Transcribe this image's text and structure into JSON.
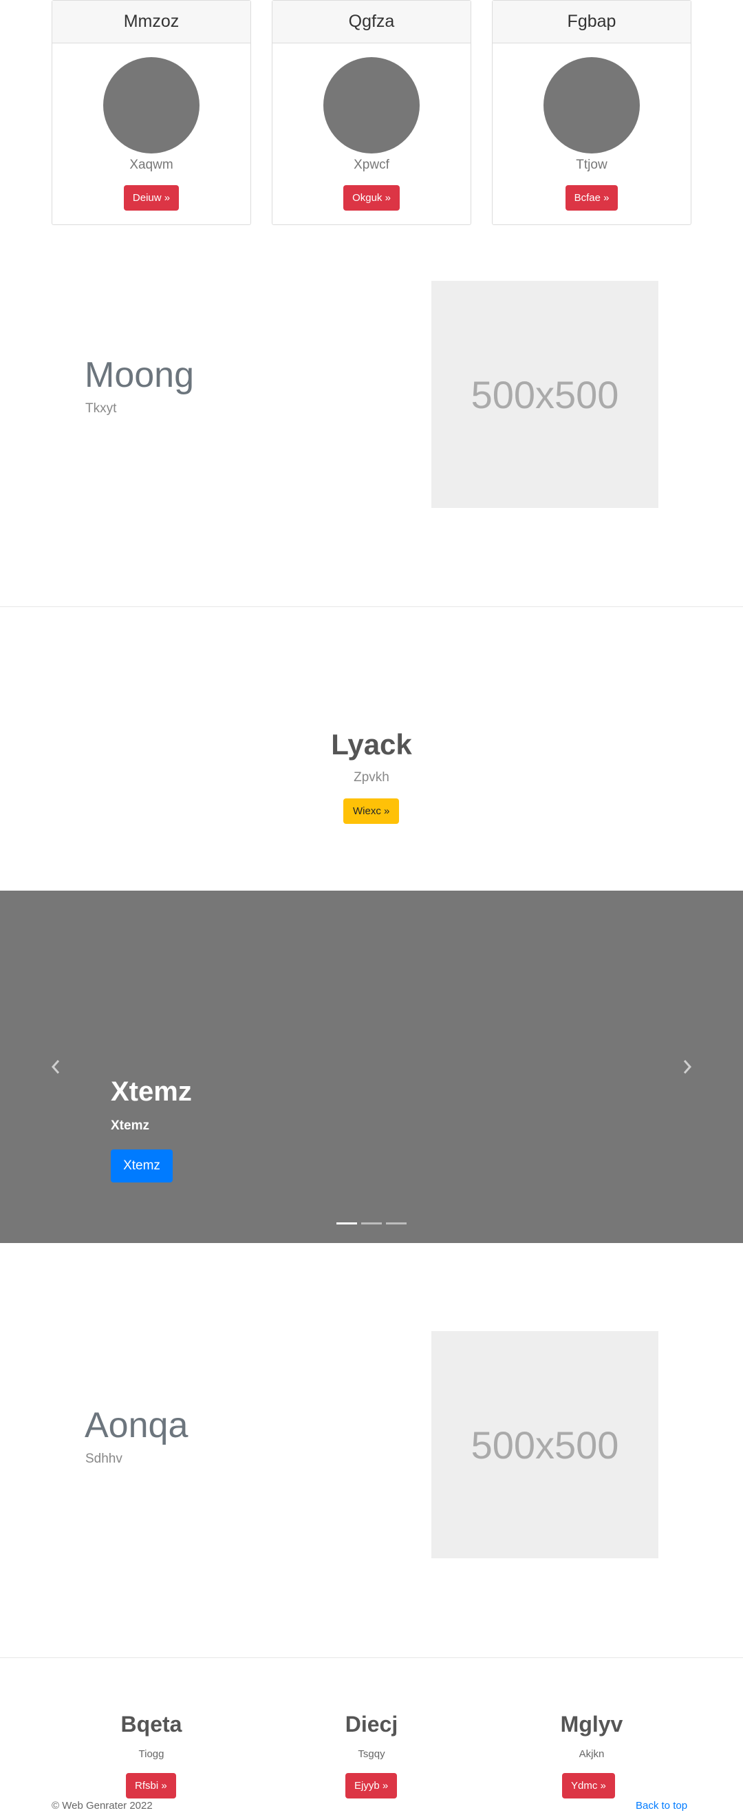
{
  "cards": [
    {
      "title": "Mmzoz",
      "subtitle": "Xaqwm",
      "button": "Deiuw »"
    },
    {
      "title": "Qgfza",
      "subtitle": "Xpwcf",
      "button": "Okguk »"
    },
    {
      "title": "Fgbap",
      "subtitle": "Ttjow",
      "button": "Bcfae »"
    }
  ],
  "feature1": {
    "title": "Moong",
    "subtitle": "Tkxyt",
    "image_label": "500x500"
  },
  "center_block": {
    "title": "Lyack",
    "subtitle": "Zpvkh",
    "button": "Wiexc »"
  },
  "carousel": {
    "title": "Xtemz",
    "subtitle": "Xtemz",
    "button": "Xtemz",
    "prev_icon": "chevron-left-icon",
    "next_icon": "chevron-right-icon",
    "slide_count": 3,
    "active_slide": 1
  },
  "feature2": {
    "title": "Aonqa",
    "subtitle": "Sdhhv",
    "image_label": "500x500"
  },
  "columns": [
    {
      "title": "Bqeta",
      "subtitle": "Tiogg",
      "button": "Rfsbi »"
    },
    {
      "title": "Diecj",
      "subtitle": "Tsgqy",
      "button": "Ejyyb »"
    },
    {
      "title": "Mglyv",
      "subtitle": "Akjkn",
      "button": "Ydmc »"
    }
  ],
  "footer": {
    "copyright": "© Web Genrater 2022",
    "back_to_top": "Back to top"
  },
  "colors": {
    "primary": "#007bff",
    "danger": "#dc3545",
    "warning": "#ffc107",
    "carousel_bg": "#777777",
    "avatar": "#777777"
  }
}
